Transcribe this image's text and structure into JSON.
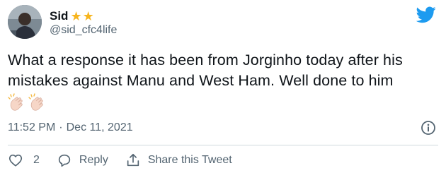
{
  "author": {
    "display_name": "Sid",
    "handle": "@sid_cfc4life",
    "badges": [
      "star-icon",
      "star-icon"
    ]
  },
  "tweet": {
    "line1": "What a response it has been from Jorginho today after his",
    "line2": "mistakes against Manu and West Ham. Well done to him",
    "emoji": [
      "clapping-hands-icon",
      "clapping-hands-icon"
    ],
    "time": "11:52 PM",
    "separator": "·",
    "date": "Dec 11, 2021"
  },
  "actions": {
    "like_count": "2",
    "reply_label": "Reply",
    "share_label": "Share this Tweet"
  },
  "colors": {
    "text": "#0f1419",
    "muted": "#536471",
    "twitter_blue": "#1d9bf0",
    "star": "#f7b51e",
    "divider": "#cfd9de"
  }
}
